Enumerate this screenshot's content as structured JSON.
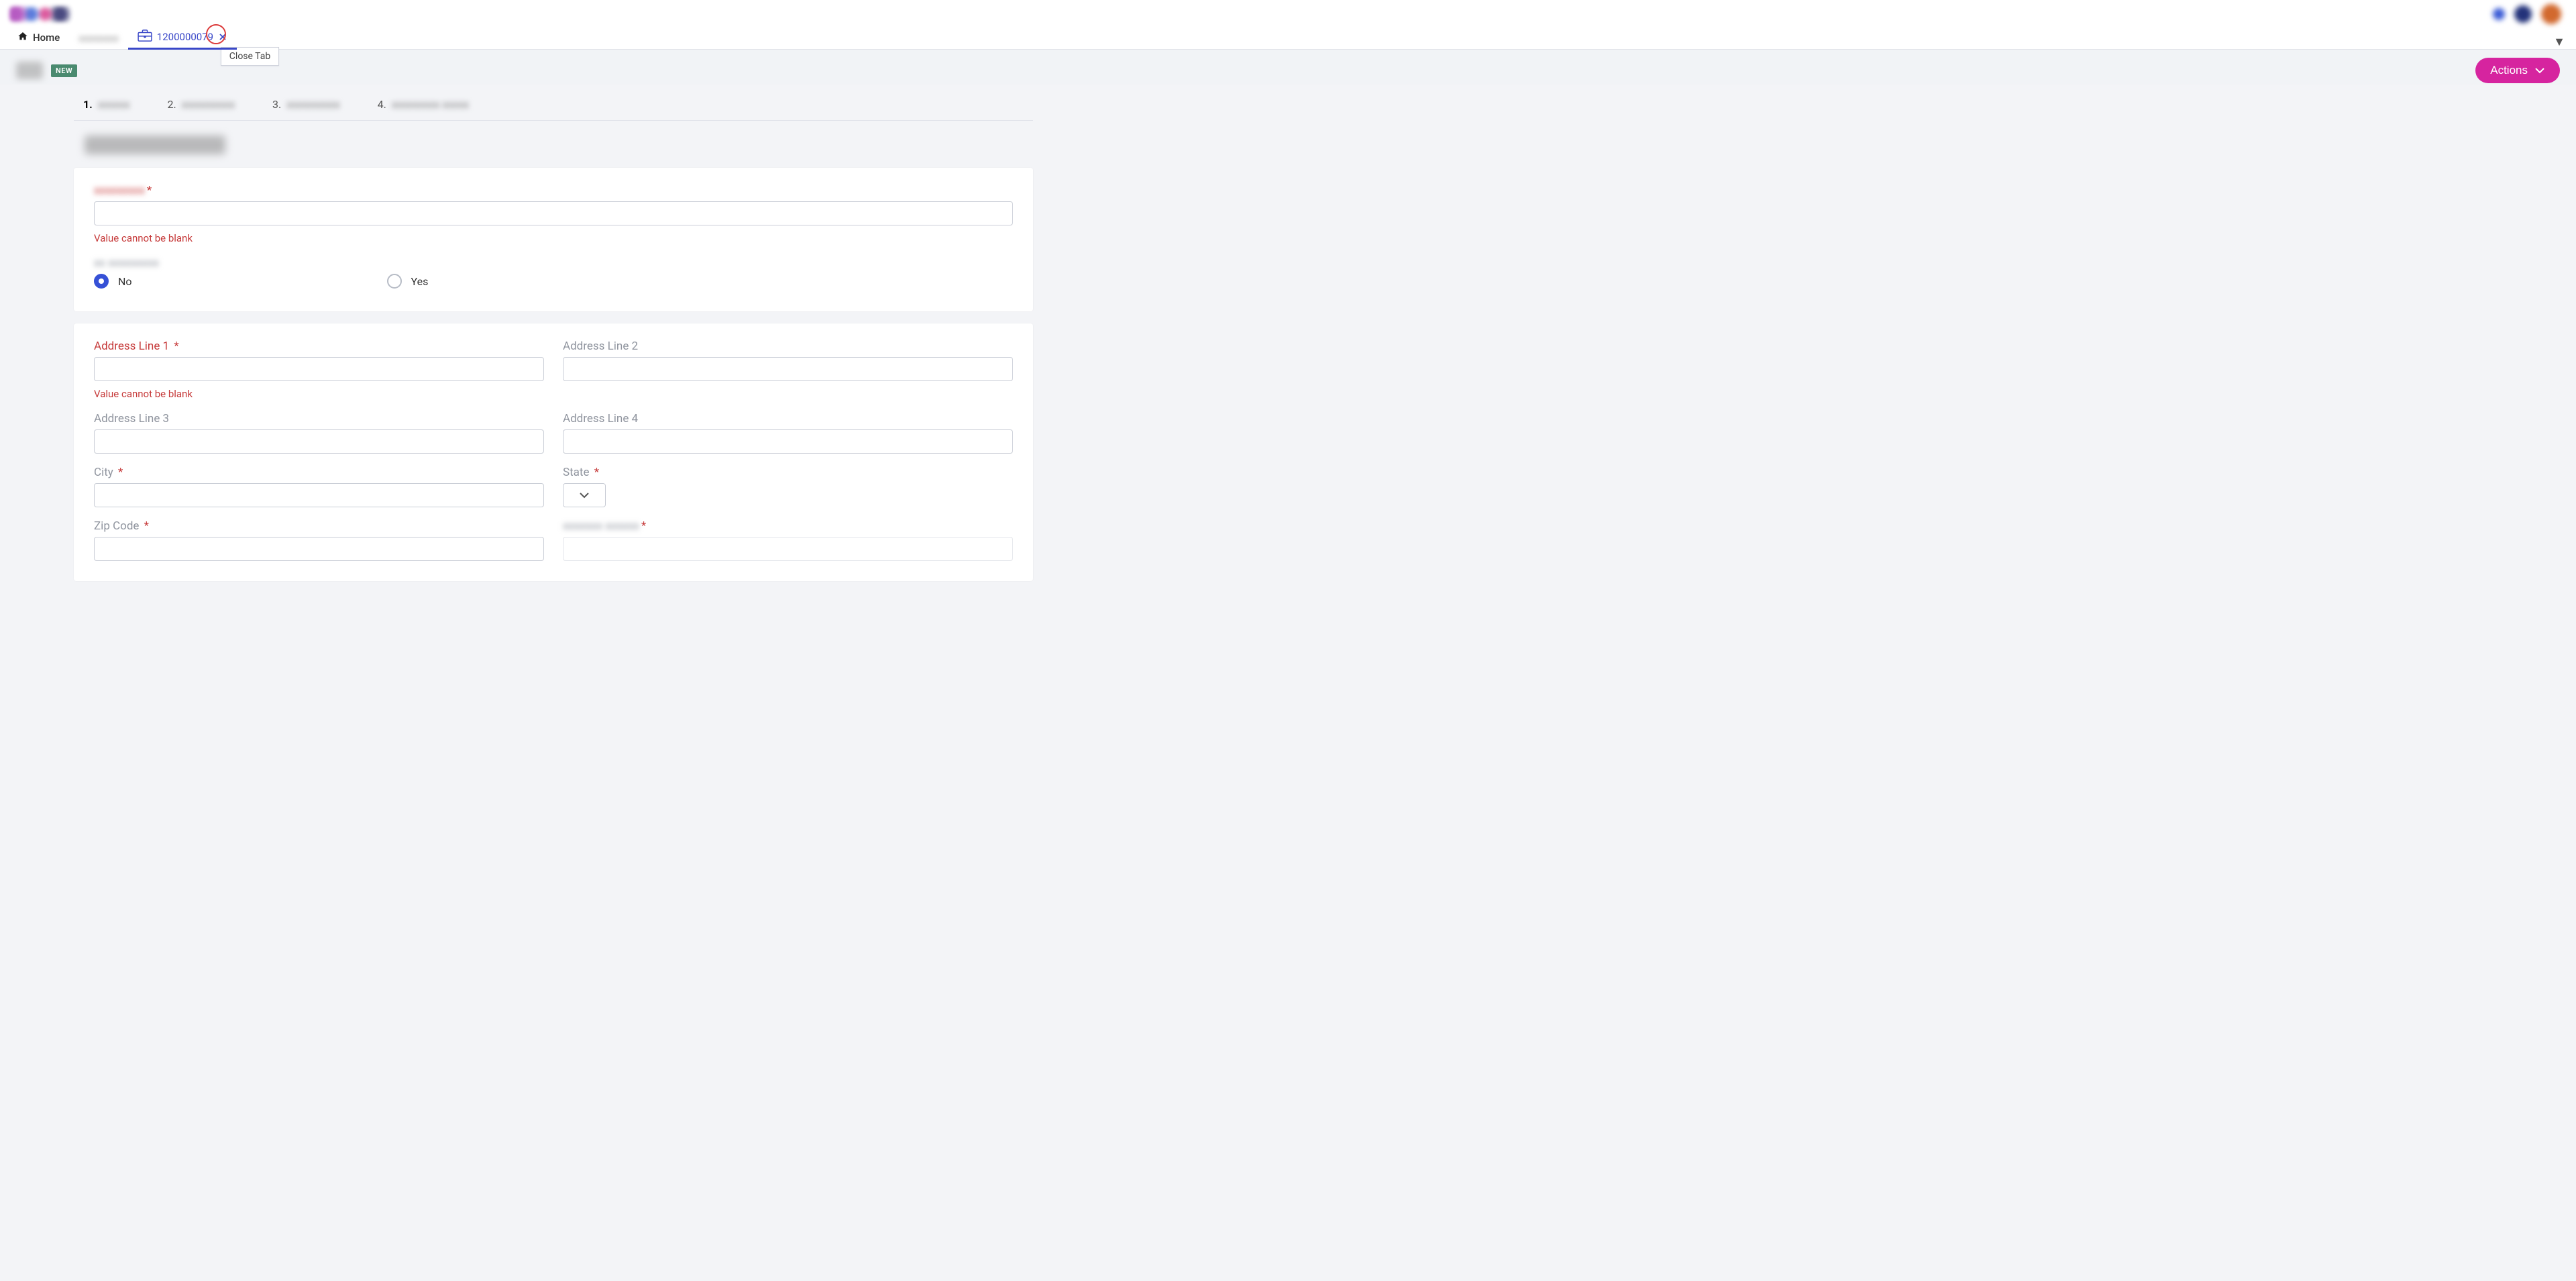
{
  "tabs": {
    "home": "Home",
    "blurred": "——",
    "active_id": "1200000079",
    "close_tooltip": "Close Tab"
  },
  "header": {
    "badge": "NEW",
    "actions": "Actions"
  },
  "stepper": {
    "s1": "1.",
    "s2": "2.",
    "s3": "3.",
    "s4": "4."
  },
  "form": {
    "err_blank": "Value cannot be blank",
    "radio_no": "No",
    "radio_yes": "Yes",
    "addr1": "Address Line 1",
    "addr2": "Address Line 2",
    "addr3": "Address Line 3",
    "addr4": "Address Line 4",
    "city": "City",
    "state": "State",
    "zip": "Zip Code"
  }
}
